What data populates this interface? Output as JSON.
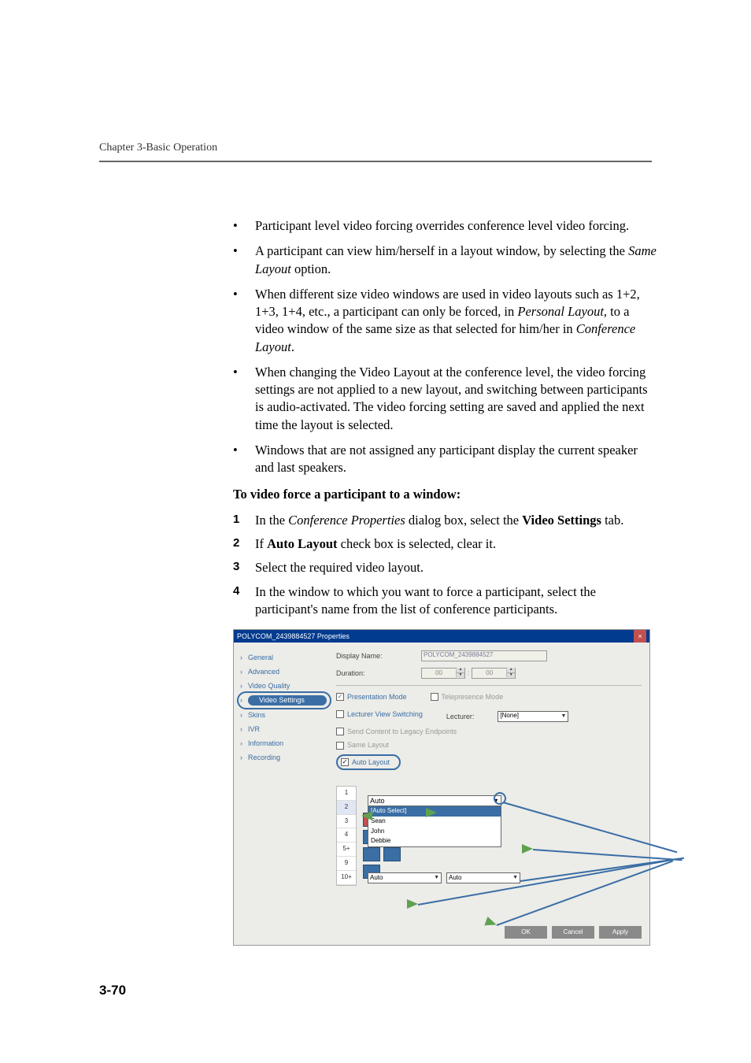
{
  "header": {
    "chapter": "Chapter 3-Basic Operation"
  },
  "bullets": [
    {
      "pre": "Participant level video forcing overrides conference level video forcing."
    },
    {
      "pre": "A participant can view him/herself in a layout window, by selecting the ",
      "ital": "Same Layout",
      "post": " option."
    },
    {
      "pre": "When different size video windows are used in video layouts such as 1+2, 1+3, 1+4, etc., a participant can only be forced, in ",
      "ital": "Personal Layout",
      "post": ", to a video window of the same size as that selected for him/her in ",
      "ital2": "Conference Layout",
      "post2": "."
    },
    {
      "pre": "When changing the Video Layout at the conference level, the video forcing settings are not applied to a new layout, and switching between participants is audio-activated. The video forcing setting are saved and applied the next time the layout is selected."
    },
    {
      "pre": "Windows that are not assigned any participant display the current speaker and last speakers."
    }
  ],
  "procedure_title": "To video force a participant to a window:",
  "steps": [
    {
      "n": "1",
      "pre": "In the ",
      "ital": "Conference Properties",
      "mid": " dialog box, select the ",
      "bold": "Video Settings",
      "post": " tab."
    },
    {
      "n": "2",
      "pre": "If ",
      "bold": "Auto Layout",
      "post": " check box is selected, clear it."
    },
    {
      "n": "3",
      "pre": "Select the required video layout."
    },
    {
      "n": "4",
      "pre": "In the window to which you want to force a participant, select the participant's name from the list of conference participants."
    }
  ],
  "dialog": {
    "title": "POLYCOM_2439884527 Properties",
    "nav": [
      "General",
      "Advanced",
      "Video Quality",
      "Video Settings",
      "Skins",
      "IVR",
      "Information",
      "Recording"
    ],
    "display_name_label": "Display Name:",
    "display_name_value": "POLYCOM_2439884527",
    "duration_label": "Duration:",
    "duration_value_h": "00",
    "duration_value_m": "00",
    "presentation_mode": "Presentation Mode",
    "telepresence_mode": "Telepresence Mode",
    "lecturer_switching": "Lecturer View Switching",
    "lecturer_label": "Lecturer:",
    "lecturer_value": "[None]",
    "send_legacy": "Send Content to Legacy Endpoints",
    "same_layout": "Same Layout",
    "auto_layout": "Auto Layout",
    "layout_counts": [
      "1",
      "2",
      "3",
      "4",
      "5+",
      "9",
      "10+"
    ],
    "dropdown_open_value": "Auto",
    "dropdown_options": [
      "[Auto Select]",
      "Sean",
      "John",
      "Debbie"
    ],
    "lower_dd1": "Auto",
    "lower_dd2": "Auto",
    "btn_ok": "OK",
    "btn_cancel": "Cancel",
    "btn_apply": "Apply"
  },
  "page_number": "3-70"
}
